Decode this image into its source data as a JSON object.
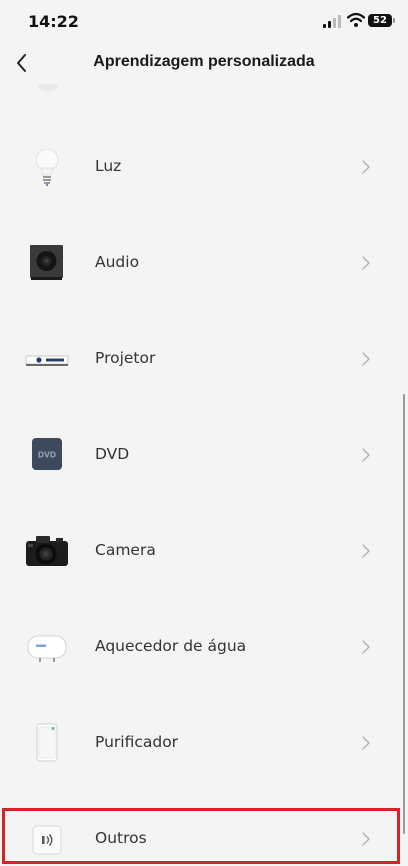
{
  "status_bar": {
    "time": "14:22",
    "battery": "52"
  },
  "header": {
    "title": "Aprendizagem personalizada"
  },
  "items": [
    {
      "label": "Luz",
      "icon": "light-bulb-icon"
    },
    {
      "label": "Audio",
      "icon": "speaker-icon"
    },
    {
      "label": "Projetor",
      "icon": "projector-icon"
    },
    {
      "label": "DVD",
      "icon": "dvd-icon",
      "icon_text": "DVD"
    },
    {
      "label": "Camera",
      "icon": "camera-icon"
    },
    {
      "label": "Aquecedor de água",
      "icon": "water-heater-icon"
    },
    {
      "label": "Purificador",
      "icon": "purifier-icon"
    },
    {
      "label": "Outros",
      "icon": "others-signal-icon"
    }
  ],
  "colors": {
    "highlight": "#d7222a",
    "background": "#f4f4f4"
  }
}
